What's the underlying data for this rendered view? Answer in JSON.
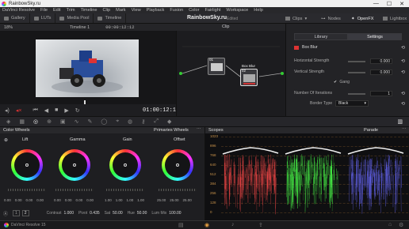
{
  "titlebar": {
    "title": "RainbowSky.ru",
    "minimize": "—",
    "maximize": "☐",
    "close": "✕"
  },
  "menu": [
    "DaVinci Resolve",
    "File",
    "Edit",
    "Trim",
    "Timeline",
    "Clip",
    "Mark",
    "View",
    "Playback",
    "Fusion",
    "Color",
    "Fairlight",
    "Workspace",
    "Help"
  ],
  "toolbar": {
    "left": [
      {
        "label": "Gallery"
      },
      {
        "label": "LUTs"
      },
      {
        "label": "Media Pool"
      },
      {
        "label": "Timeline"
      }
    ],
    "project_name": "RainbowSky.ru",
    "project_status": "Edited",
    "right": [
      {
        "label": "Clips"
      },
      {
        "label": "Nodes"
      },
      {
        "label": "OpenFX"
      },
      {
        "label": "Lightbox"
      }
    ]
  },
  "viewer": {
    "zoom": "18%",
    "timeline_name": "Timeline 1",
    "timecode": "00:00:12:12",
    "clip_label": "Clip",
    "transport_timecode": "01:00:12:12"
  },
  "nodes": {
    "node1": {
      "label": "01"
    },
    "node2": {
      "label": "Box Blur",
      "number": "02"
    }
  },
  "openfx": {
    "tabs": [
      "Library",
      "Settings"
    ],
    "active_tab": "Settings",
    "effect_name": "Box Blur",
    "params": [
      {
        "label": "Horizontal Strength",
        "value": "0.000"
      },
      {
        "label": "Vertical Strength",
        "value": "0.000"
      },
      {
        "label": "Gang",
        "value": ""
      },
      {
        "label": "Number Of Iterations",
        "value": "1"
      },
      {
        "label": "Border Type",
        "value": "Black"
      }
    ]
  },
  "color_wheels": {
    "title": "Color Wheels",
    "mode": "Primaries Wheels",
    "wheels": [
      {
        "label": "Lift",
        "values": [
          "0.00",
          "0.00",
          "0.00",
          "0.00"
        ]
      },
      {
        "label": "Gamma",
        "values": [
          "0.00",
          "0.00",
          "0.00",
          "0.00"
        ]
      },
      {
        "label": "Gain",
        "values": [
          "1.00",
          "1.00",
          "1.00",
          "1.00"
        ]
      },
      {
        "label": "Offset",
        "values": [
          "25.00",
          "25.00",
          "25.00",
          ""
        ]
      }
    ],
    "bottom": {
      "page1": "1",
      "page2": "2",
      "contrast_label": "Contrast",
      "contrast": "1.000",
      "pivot_label": "Pivot",
      "pivot": "0.435",
      "sat_label": "Sat",
      "sat": "50.00",
      "hue_label": "Hue",
      "hue": "50.00",
      "lummix_label": "Lum Mix",
      "lummix": "100.00"
    }
  },
  "scopes": {
    "title": "Scopes",
    "mode": "Parade",
    "scale": [
      "1023",
      "896",
      "768",
      "640",
      "512",
      "384",
      "256",
      "128",
      "0"
    ],
    "colors": {
      "red": "#ff4a4a",
      "green": "#4aff4a",
      "blue": "#6a6aff"
    }
  },
  "statusbar": {
    "app": "DaVinci Resolve 15"
  }
}
